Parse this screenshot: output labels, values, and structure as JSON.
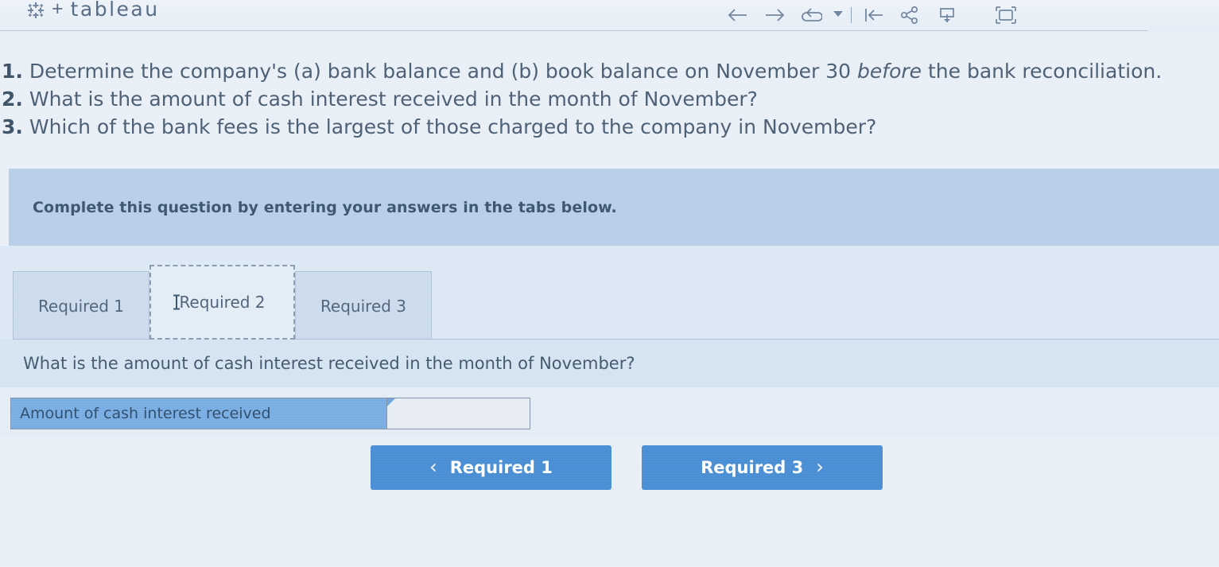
{
  "toolbar": {
    "brand_word": "tableau",
    "brand_plus": "+",
    "icons": [
      {
        "name": "back-arrow-icon",
        "label": "Back"
      },
      {
        "name": "forward-arrow-icon",
        "label": "Forward"
      },
      {
        "name": "revert-icon",
        "label": "Revert"
      },
      {
        "name": "revert-dropdown-caret-icon",
        "label": "Revert options"
      },
      {
        "name": "reset-icon",
        "label": "Reset"
      },
      {
        "name": "share-icon",
        "label": "Share"
      },
      {
        "name": "download-icon",
        "label": "Download"
      },
      {
        "name": "fullscreen-icon",
        "label": "Full screen"
      }
    ]
  },
  "questions": [
    {
      "number": "1.",
      "text_before": " Determine the company's (a) bank balance and (b) book balance on November 30 ",
      "italic": "before",
      "text_after": " the bank reconciliation."
    },
    {
      "number": "2.",
      "text_before": " What is the amount of cash interest received in the month of November?",
      "italic": "",
      "text_after": ""
    },
    {
      "number": "3.",
      "text_before": " Which of the bank fees is the largest of those charged to the company in November?",
      "italic": "",
      "text_after": ""
    }
  ],
  "banner": {
    "message": "Complete this question by entering your answers in the tabs below."
  },
  "tabs": [
    {
      "label": "Required 1",
      "active": false
    },
    {
      "label": "Required 2",
      "active": true
    },
    {
      "label": "Required 3",
      "active": false
    }
  ],
  "sub_question": {
    "prompt": "What is the amount of cash interest received in the month of November?"
  },
  "answer": {
    "row_label": "Amount of cash interest received",
    "value": "",
    "placeholder": ""
  },
  "navigation": {
    "prev_label": "Required 1",
    "prev_chevron": "‹",
    "next_label": "Required 3",
    "next_chevron": "›"
  },
  "colors": {
    "page_background": "#e9eff6",
    "banner_background": "#b9cee8",
    "tabstrip_background": "#dce8f4",
    "tab_inactive": "#ccdcec",
    "tab_active": "#e3edf6",
    "subquestion_background": "#d4e4f1",
    "answer_label_blue": "#7aaee3",
    "button_blue": "#4a8ed4",
    "text_blue_gray": "#4c5f74"
  }
}
